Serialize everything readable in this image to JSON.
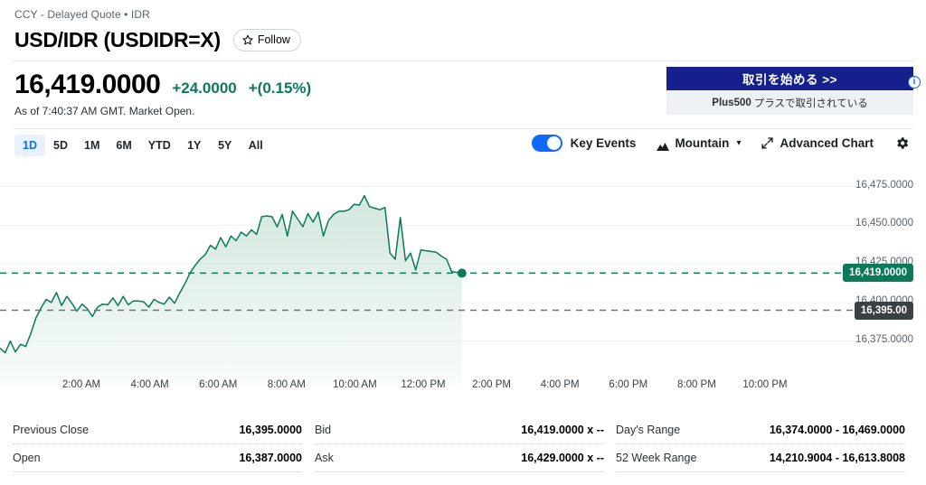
{
  "header": {
    "quote_meta": "CCY - Delayed Quote • IDR",
    "symbol_title": "USD/IDR (USDIDR=X)",
    "follow_label": "Follow",
    "follow_icon": "star-outline-icon"
  },
  "price": {
    "last": "16,419.0000",
    "change": "+24.0000",
    "change_percent": "+(0.15%)",
    "as_of": "As of 7:40:37 AM GMT. Market Open.",
    "positive_color": "#0a7a5a"
  },
  "ad": {
    "cta": "取引を始める >>",
    "brand": "Plus500",
    "sub": "プラスで取引されている",
    "info_icon": "info-circle-icon",
    "cta_bg": "#16208c"
  },
  "toolbar": {
    "ranges": [
      {
        "label": "1D",
        "active": true
      },
      {
        "label": "5D",
        "active": false
      },
      {
        "label": "1M",
        "active": false
      },
      {
        "label": "6M",
        "active": false
      },
      {
        "label": "YTD",
        "active": false
      },
      {
        "label": "1Y",
        "active": false
      },
      {
        "label": "5Y",
        "active": false
      },
      {
        "label": "All",
        "active": false
      }
    ],
    "key_events_label": "Key Events",
    "key_events_on": true,
    "chart_type_label": "Mountain",
    "chart_type_icon": "mountain-icon",
    "chevron_icon": "chevron-down-icon",
    "advanced_chart_label": "Advanced Chart",
    "advanced_chart_icon": "expand-arrows-icon",
    "settings_icon": "gear-icon"
  },
  "chart_data": {
    "type": "area",
    "title": "",
    "xlabel": "",
    "ylabel": "",
    "ylim": [
      16362,
      16487
    ],
    "yticks": [
      "16,475.0000",
      "16,450.0000",
      "16,425.0000",
      "16,400.0000",
      "16,375.0000"
    ],
    "ytick_values": [
      16475,
      16450,
      16425,
      16400,
      16375
    ],
    "xticks": [
      "2:00 AM",
      "4:00 AM",
      "6:00 AM",
      "8:00 AM",
      "10:00 AM",
      "12:00 PM",
      "2:00 PM",
      "4:00 PM",
      "6:00 PM",
      "8:00 PM",
      "10:00 PM"
    ],
    "grid": true,
    "legend": "none",
    "line_color": "#0a7a5a",
    "fill_color": "#cfe6dc",
    "current_price_badge": "16,419.0000",
    "previous_close_badge": "16,395.00",
    "current_price_value": 16419,
    "previous_close_value": 16395,
    "series": [
      {
        "name": "USD/IDR",
        "points": [
          [
            0.0,
            16370.5
          ],
          [
            0.3,
            16367.5
          ],
          [
            0.6,
            16375.0
          ],
          [
            0.9,
            16368.0
          ],
          [
            1.2,
            16373.0
          ],
          [
            1.5,
            16371.5
          ],
          [
            1.8,
            16380.0
          ],
          [
            2.1,
            16390.0
          ],
          [
            2.4,
            16396.5
          ],
          [
            2.7,
            16402.0
          ],
          [
            3.0,
            16400.0
          ],
          [
            3.3,
            16406.5
          ],
          [
            3.6,
            16398.0
          ],
          [
            3.9,
            16404.0
          ],
          [
            4.2,
            16399.5
          ],
          [
            4.5,
            16394.5
          ],
          [
            4.8,
            16399.0
          ],
          [
            5.1,
            16396.0
          ],
          [
            5.4,
            16391.0
          ],
          [
            5.7,
            16397.0
          ],
          [
            6.0,
            16399.0
          ],
          [
            6.3,
            16398.5
          ],
          [
            6.6,
            16403.0
          ],
          [
            6.9,
            16398.0
          ],
          [
            7.2,
            16404.0
          ],
          [
            7.5,
            16398.5
          ],
          [
            7.8,
            16401.0
          ],
          [
            8.1,
            16401.0
          ],
          [
            8.4,
            16400.5
          ],
          [
            8.7,
            16397.0
          ],
          [
            9.0,
            16402.0
          ],
          [
            9.3,
            16400.0
          ],
          [
            9.6,
            16399.0
          ],
          [
            9.9,
            16403.5
          ],
          [
            10.2,
            16399.5
          ],
          [
            10.5,
            16406.0
          ],
          [
            10.8,
            16412.0
          ],
          [
            11.1,
            16419.0
          ],
          [
            11.4,
            16424.0
          ],
          [
            11.7,
            16428.0
          ],
          [
            12.0,
            16431.0
          ],
          [
            12.3,
            16437.0
          ],
          [
            12.6,
            16434.5
          ],
          [
            12.9,
            16442.0
          ],
          [
            13.2,
            16436.0
          ],
          [
            13.5,
            16443.0
          ],
          [
            13.8,
            16440.0
          ],
          [
            14.1,
            16445.5
          ],
          [
            14.4,
            16443.0
          ],
          [
            14.7,
            16447.0
          ],
          [
            15.0,
            16444.0
          ],
          [
            15.3,
            16455.5
          ],
          [
            15.6,
            16456.0
          ],
          [
            15.9,
            16455.5
          ],
          [
            16.2,
            16449.0
          ],
          [
            16.5,
            16457.0
          ],
          [
            16.8,
            16443.0
          ],
          [
            17.1,
            16459.0
          ],
          [
            17.4,
            16454.0
          ],
          [
            17.7,
            16449.0
          ],
          [
            18.0,
            16457.5
          ],
          [
            18.3,
            16452.0
          ],
          [
            18.6,
            16458.5
          ],
          [
            18.9,
            16443.0
          ],
          [
            19.2,
            16453.0
          ],
          [
            19.5,
            16457.0
          ],
          [
            19.8,
            16459.0
          ],
          [
            20.1,
            16459.0
          ],
          [
            20.4,
            16460.0
          ],
          [
            20.7,
            16463.5
          ],
          [
            21.0,
            16463.0
          ],
          [
            21.3,
            16469.0
          ],
          [
            21.6,
            16462.0
          ],
          [
            21.9,
            16461.0
          ],
          [
            22.2,
            16460.0
          ],
          [
            22.5,
            16461.5
          ],
          [
            22.8,
            16432.0
          ],
          [
            23.1,
            16428.0
          ],
          [
            23.4,
            16455.0
          ],
          [
            23.7,
            16427.0
          ],
          [
            24.0,
            16432.0
          ],
          [
            24.3,
            16421.0
          ],
          [
            24.6,
            16434.0
          ],
          [
            24.9,
            16433.5
          ],
          [
            25.2,
            16433.0
          ],
          [
            25.5,
            16432.5
          ],
          [
            25.8,
            16430.0
          ],
          [
            26.1,
            16428.0
          ],
          [
            26.4,
            16420.0
          ],
          [
            26.7,
            16419.5
          ],
          [
            27.0,
            16419.0
          ]
        ]
      }
    ]
  },
  "stats": {
    "columns": [
      {
        "rows": [
          {
            "label": "Previous Close",
            "value": "16,395.0000"
          },
          {
            "label": "Open",
            "value": "16,387.0000"
          }
        ]
      },
      {
        "rows": [
          {
            "label": "Bid",
            "value": "16,419.0000 x --"
          },
          {
            "label": "Ask",
            "value": "16,429.0000 x --"
          }
        ]
      },
      {
        "rows": [
          {
            "label": "Day's Range",
            "value": "16,374.0000 - 16,469.0000"
          },
          {
            "label": "52 Week Range",
            "value": "14,210.9004 - 16,613.8008"
          }
        ]
      }
    ]
  }
}
